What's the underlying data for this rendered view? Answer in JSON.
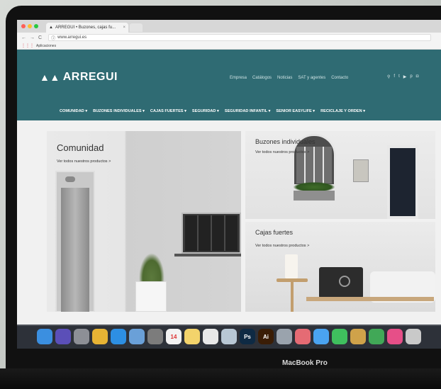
{
  "browser": {
    "tab_title": "ARREGUI • Buzones, cajas fu...",
    "tab_close": "×",
    "url": "www.arregui.es",
    "bookmarks_label": "Aplicaciones",
    "dot_colors": [
      "#ff5f56",
      "#ffbd2e",
      "#27c93f"
    ]
  },
  "site": {
    "brand": "ARREGUI",
    "top_nav": [
      "Empresa",
      "Catálogos",
      "Noticias",
      "SAT y agentes",
      "Contacto"
    ],
    "main_nav": [
      "COMUNIDAD ▾",
      "BUZONES INDIVIDUALES ▾",
      "CAJAS FUERTES ▾",
      "SEGURIDAD ▾",
      "SEGURIDAD INFANTIL ▾",
      "SENIOR EASYLIFE ▾",
      "RECICLAJE Y ORDEN ▾"
    ],
    "header_color": "#2f6b73"
  },
  "tiles": {
    "comunidad": {
      "title": "Comunidad",
      "link": "Ver todos nuestros productos >"
    },
    "buzones": {
      "title": "Buzones individuales",
      "link": "Ver todos nuestros productos >"
    },
    "cajas": {
      "title": "Cajas fuertes",
      "link": "Ver todos nuestros productos >"
    }
  },
  "dock": {
    "apps": [
      {
        "icon": "finder-icon",
        "label": "",
        "color": "#3b8fe0"
      },
      {
        "icon": "siri-icon",
        "label": "",
        "color": "#5b4fb8"
      },
      {
        "icon": "launchpad-icon",
        "label": "",
        "color": "#8d8f96"
      },
      {
        "icon": "chrome-icon",
        "label": "",
        "color": "#e7b334"
      },
      {
        "icon": "safari-icon",
        "label": "",
        "color": "#2d8fe3"
      },
      {
        "icon": "photos-icon",
        "label": "",
        "color": "#6aa0d8"
      },
      {
        "icon": "system-preferences-icon",
        "label": "",
        "color": "#7c7c7c"
      },
      {
        "icon": "calendar-icon",
        "label": "14",
        "color": "#f2f2f2"
      },
      {
        "icon": "notes-icon",
        "label": "",
        "color": "#f3d36b"
      },
      {
        "icon": "textedit-icon",
        "label": "",
        "color": "#e8e8e8"
      },
      {
        "icon": "preview-icon",
        "label": "",
        "color": "#b8c7d4"
      },
      {
        "icon": "photoshop-icon",
        "label": "Ps",
        "color": "#0e2a44"
      },
      {
        "icon": "illustrator-icon",
        "label": "Ai",
        "color": "#3a1d06"
      },
      {
        "icon": "app-icon",
        "label": "",
        "color": "#9aa3ad"
      },
      {
        "icon": "photos-app-icon",
        "label": "",
        "color": "#e56b74"
      },
      {
        "icon": "messages-icon",
        "label": "",
        "color": "#4aa3f0"
      },
      {
        "icon": "facetime-icon",
        "label": "",
        "color": "#3fbf5e"
      },
      {
        "icon": "mail-icon",
        "label": "",
        "color": "#cfa24a"
      },
      {
        "icon": "numbers-icon",
        "label": "",
        "color": "#41a857"
      },
      {
        "icon": "itunes-icon",
        "label": "",
        "color": "#e64f88"
      },
      {
        "icon": "trash-icon",
        "label": "",
        "color": "#c9c9c9"
      }
    ]
  },
  "device_label": "MacBook Pro"
}
